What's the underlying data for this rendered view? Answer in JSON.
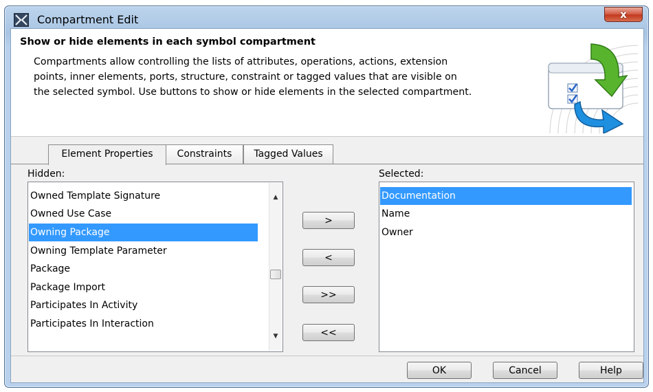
{
  "window": {
    "title": "Compartment Edit",
    "close_glyph": "x"
  },
  "header": {
    "title": "Show or hide elements in each symbol compartment",
    "desc_lines": [
      "Compartments allow controlling the lists of attributes, operations, actions, extension",
      "points, inner elements, ports, structure, constraint or tagged values that are visible on",
      "the selected symbol. Use buttons to show or hide elements in the selected compartment."
    ]
  },
  "tabs": [
    {
      "label": "Element Properties",
      "active": true
    },
    {
      "label": "Constraints",
      "active": false
    },
    {
      "label": "Tagged Values",
      "active": false
    }
  ],
  "hidden": {
    "label": "Hidden:",
    "items": [
      "Owned Template Signature",
      "Owned Use Case",
      "Owning Package",
      "Owning Template Parameter",
      "Package",
      "Package Import",
      "Participates In Activity",
      "Participates In Interaction"
    ],
    "selected_item": "Owning Package"
  },
  "selected": {
    "label": "Selected:",
    "items": [
      "Documentation",
      "Name",
      "Owner"
    ],
    "selected_item": "Documentation"
  },
  "move_buttons": {
    "add": ">",
    "remove": "<",
    "add_all": ">>",
    "remove_all": "<<"
  },
  "dialog_buttons": {
    "ok": "OK",
    "cancel": "Cancel",
    "help": "Help"
  },
  "icons": {
    "app": "magicdraw-app-icon",
    "header": "compartment-move-icon",
    "close": "close-icon"
  },
  "colors": {
    "selection": "#3399ff",
    "title_bar": "#b9d1ec",
    "close_button": "#c9472f"
  }
}
